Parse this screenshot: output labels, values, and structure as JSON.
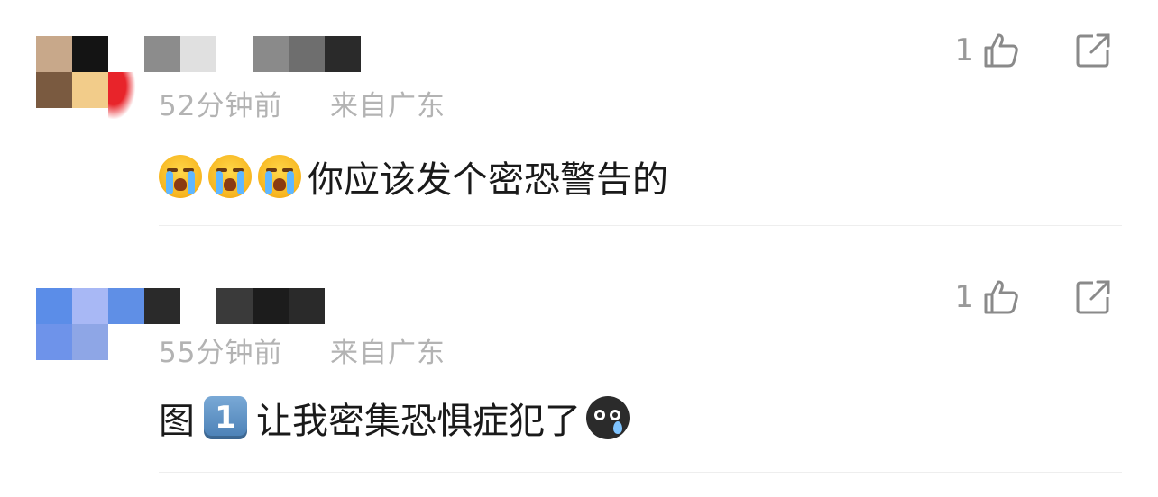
{
  "comments": [
    {
      "time": "52分钟前",
      "location": "来自广东",
      "text": "你应该发个密恐警告的",
      "like_count": "1",
      "emoji_prefix": [
        "loudly-crying-face",
        "loudly-crying-face",
        "loudly-crying-face"
      ],
      "avatar_colors": [
        "#c8a88a",
        "#141414",
        "#7a5a40",
        "#f2cc8a",
        "#e8242a"
      ],
      "name_colors": [
        "#8c8c8c",
        "#e0e0e0",
        "#8a8a8a",
        "#6e6e6e",
        "#2a2a2a"
      ]
    },
    {
      "time": "55分钟前",
      "location": "来自广东",
      "text_before": "图",
      "keycap": "1",
      "text": "让我密集恐惧症犯了",
      "emoji_suffix": "sad-tear-face",
      "like_count": "1",
      "avatar_colors": [
        "#5b8de8",
        "#a8b8f5",
        "#6e93ea",
        "#5f8fe6",
        "#8ea6e6"
      ],
      "name_colors": [
        "#2a2a2a",
        "#3a3a3a",
        "#1c1c1c"
      ]
    }
  ],
  "icons": {
    "like": "thumbs-up-icon",
    "share": "share-icon"
  },
  "colors": {
    "meta_text": "#b3b3b3",
    "body_text": "#1a1a1a",
    "divider": "#eeeeee"
  }
}
